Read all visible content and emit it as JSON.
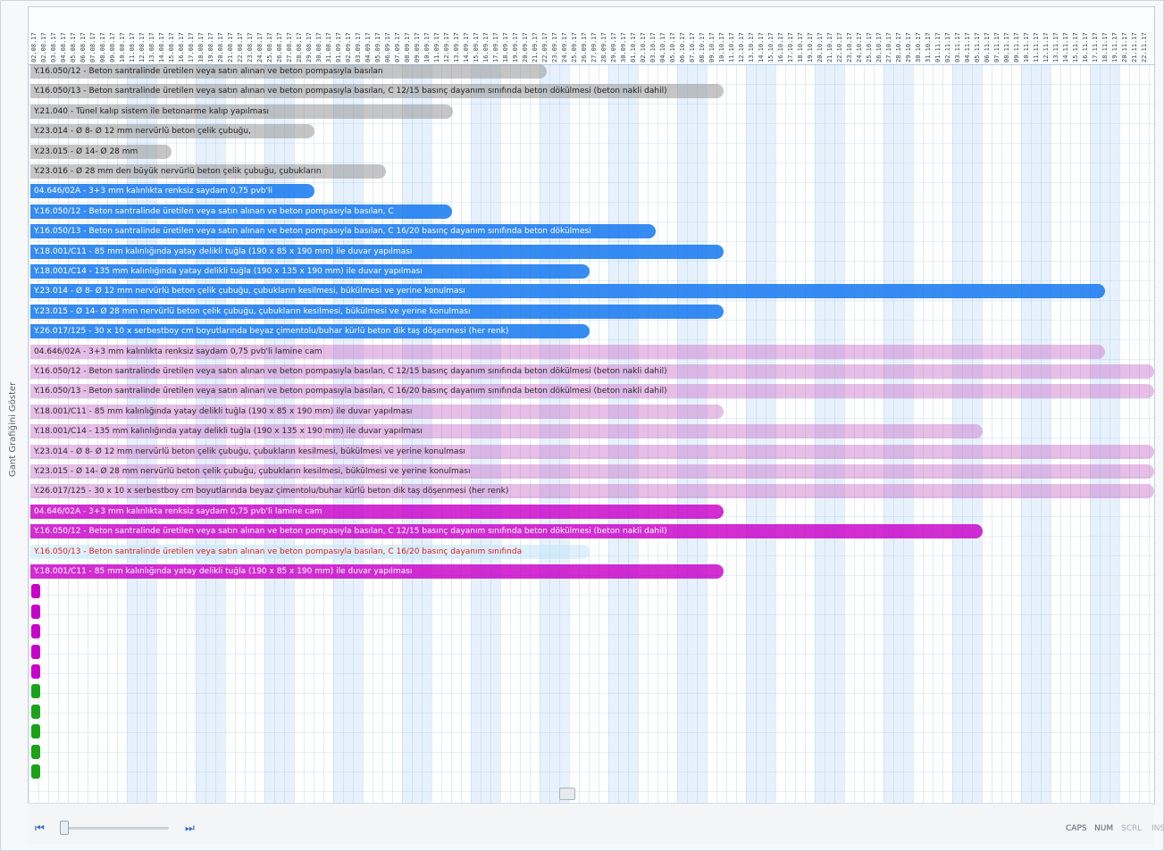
{
  "app": {
    "side_title": "Gant Grafiğini Göster"
  },
  "header": {
    "dates": [
      "02.08.17",
      "02.08.17",
      "03.08.17",
      "04.08.17",
      "05.08.17",
      "06.08.17",
      "07.08.17",
      "08.08.17",
      "09.08.17",
      "10.08.17",
      "11.08.17",
      "12.08.17",
      "13.08.17",
      "14.08.17",
      "15.08.17",
      "16.08.17",
      "17.08.17",
      "18.08.17",
      "19.08.17",
      "20.08.17",
      "21.08.17",
      "22.08.17",
      "23.08.17",
      "24.08.17",
      "25.08.17",
      "26.08.17",
      "27.08.17",
      "28.08.17",
      "29.08.17",
      "30.08.17",
      "31.08.17",
      "01.09.17",
      "02.09.17",
      "03.09.17",
      "04.09.17",
      "05.09.17",
      "06.09.17",
      "07.09.17",
      "08.09.17",
      "09.09.17",
      "10.09.17",
      "11.09.17",
      "12.09.17",
      "13.09.17",
      "14.09.17",
      "15.09.17",
      "16.09.17",
      "17.09.17",
      "18.09.17",
      "19.09.17",
      "20.09.17",
      "21.09.17",
      "22.09.17",
      "23.09.17",
      "24.09.17",
      "25.09.17",
      "26.09.17",
      "27.09.17",
      "28.09.17",
      "29.09.17",
      "30.09.17",
      "01.10.17",
      "02.10.17",
      "03.10.17",
      "04.10.17",
      "05.10.17",
      "06.10.17",
      "07.10.17",
      "08.10.17",
      "09.10.17",
      "10.10.17",
      "11.10.17",
      "12.10.17",
      "13.10.17",
      "14.10.17",
      "15.10.17",
      "16.10.17",
      "17.10.17",
      "18.10.17",
      "19.10.17",
      "20.10.17",
      "21.10.17",
      "22.10.17",
      "23.10.17",
      "24.10.17",
      "25.10.17",
      "26.10.17",
      "27.10.17",
      "28.10.17",
      "29.10.17",
      "30.10.17",
      "31.10.17",
      "01.11.17",
      "02.11.17",
      "03.11.17",
      "04.11.17",
      "05.11.17",
      "06.11.17",
      "07.11.17",
      "08.11.17",
      "09.11.17",
      "10.11.17",
      "11.11.17",
      "12.11.17",
      "13.11.17",
      "14.11.17",
      "15.11.17",
      "16.11.17",
      "17.11.17",
      "18.11.17",
      "19.11.17",
      "20.11.17",
      "21.11.17",
      "22.11.17"
    ]
  },
  "tasks": [
    {
      "label": "Y.16.050/12 - Beton santralinde üretilen veya satın alınan ve beton pompasıyla basılan",
      "color": "gray"
    },
    {
      "label": "Y.16.050/13 - Beton santralinde üretilen veya satın alınan ve beton pompasıyla basılan, C 12/15 basınç dayanım sınıfında beton dökülmesi (beton nakli dahil)",
      "color": "gray"
    },
    {
      "label": "Y.21.040 - Tünel kalıp sistem ile betonarme kalıp yapılması",
      "color": "gray"
    },
    {
      "label": "Y.23.014 - Ø 8- Ø 12 mm nervürlü beton çelik çubuğu,",
      "color": "gray"
    },
    {
      "label": "Y.23.015 - Ø 14- Ø 28 mm",
      "color": "gray"
    },
    {
      "label": "Y.23.016 - Ø 28 mm den büyük nervürlü beton çelik çubuğu, çubukların",
      "color": "gray"
    },
    {
      "label": "04.646/02A - 3+3 mm kalınlıkta renksiz saydam 0,75 pvb'li",
      "color": "blue"
    },
    {
      "label": "Y.16.050/12 - Beton santralinde üretilen veya satın alınan ve beton pompasıyla basılan, C",
      "color": "blue"
    },
    {
      "label": "Y.16.050/13 - Beton santralinde üretilen veya satın alınan ve beton pompasıyla basılan, C 16/20 basınç dayanım sınıfında beton dökülmesi",
      "color": "blue"
    },
    {
      "label": "Y.18.001/C11 - 85 mm kalınlığında yatay delikli tuğla (190 x 85 x 190 mm) ile duvar yapılması",
      "color": "blue"
    },
    {
      "label": "Y.18.001/C14 - 135 mm kalınlığında yatay delikli tuğla (190 x 135 x 190 mm) ile duvar yapılması",
      "color": "blue"
    },
    {
      "label": "Y.23.014 - Ø 8- Ø 12 mm nervürlü beton çelik çubuğu, çubukların kesilmesi, bükülmesi ve yerine konulması",
      "color": "blue"
    },
    {
      "label": "Y.23.015 - Ø 14- Ø 28 mm nervürlü beton çelik çubuğu, çubukların kesilmesi, bükülmesi ve yerine konulması",
      "color": "blue"
    },
    {
      "label": "Y.26.017/125 - 30 x 10 x serbestboy cm boyutlarında beyaz çimentolu/buhar kürlü beton dik taş döşenmesi (her renk)",
      "color": "blue"
    },
    {
      "label": "04.646/02A - 3+3 mm kalınlıkta renksiz saydam 0,75 pvb'li lamine cam",
      "color": "pink"
    },
    {
      "label": "Y.16.050/12 - Beton santralinde üretilen veya satın alınan ve beton pompasıyla basılan, C 12/15 basınç dayanım sınıfında beton dökülmesi (beton nakli dahil)",
      "color": "pink"
    },
    {
      "label": "Y.16.050/13 - Beton santralinde üretilen veya satın alınan ve beton pompasıyla basılan, C 16/20 basınç dayanım sınıfında beton dökülmesi (beton nakli dahil)",
      "color": "pink"
    },
    {
      "label": "Y.18.001/C11 - 85 mm kalınlığında yatay delikli tuğla (190 x 85 x 190 mm) ile duvar yapılması",
      "color": "pink"
    },
    {
      "label": "Y.18.001/C14 - 135 mm kalınlığında yatay delikli tuğla (190 x 135 x 190 mm) ile duvar yapılması",
      "color": "pink"
    },
    {
      "label": "Y.23.014 - Ø 8- Ø 12 mm nervürlü beton çelik çubuğu, çubukların kesilmesi, bükülmesi ve yerine konulması",
      "color": "pink"
    },
    {
      "label": "Y.23.015 - Ø 14- Ø 28 mm nervürlü beton çelik çubuğu, çubukların kesilmesi, bükülmesi ve yerine konulması",
      "color": "pink"
    },
    {
      "label": "Y.26.017/125 - 30 x 10 x serbestboy cm boyutlarında beyaz çimentolu/buhar kürlü beton dik taş döşenmesi (her renk)",
      "color": "pink"
    },
    {
      "label": "04.646/02A - 3+3 mm kalınlıkta renksiz saydam 0,75 pvb'li lamine cam",
      "color": "magenta"
    },
    {
      "label": "Y.16.050/12 - Beton santralinde üretilen veya satın alınan ve beton pompasıyla basılan, C 12/15 basınç dayanım sınıfında beton dökülmesi (beton nakli dahil)",
      "color": "magenta"
    },
    {
      "label": "Y.16.050/13 - Beton santralinde üretilen veya satın alınan ve beton pompasıyla basılan, C 16/20 basınç dayanım sınıfında",
      "color": "red-text"
    },
    {
      "label": "Y.18.001/C11 - 85 mm kalınlığında yatay delikli tuğla (190 x 85 x 190 mm) ile duvar yapılması",
      "color": "magenta"
    }
  ],
  "empty_rows": [
    "magenta",
    "magenta",
    "magenta",
    "magenta",
    "magenta",
    "green",
    "green",
    "green",
    "green",
    "green"
  ],
  "status": {
    "caps": "CAPS",
    "num": "NUM",
    "scrl": "SCRL",
    "ins": "INS"
  },
  "nav": {
    "first": "⏮",
    "last": "⏭"
  },
  "colors": {
    "gray": "#969696",
    "blue": "#1478f0",
    "pink": "#c86ec8",
    "magenta": "#c800c8",
    "green": "#1aa21a"
  }
}
